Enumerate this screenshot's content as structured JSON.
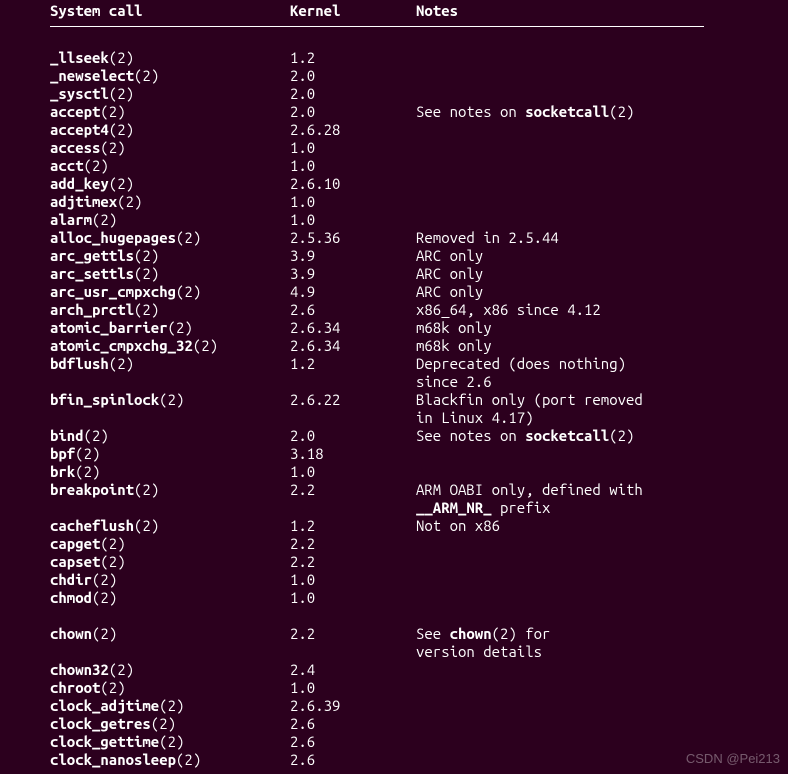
{
  "headers": {
    "col1": "System call",
    "col2": "Kernel",
    "col3": "Notes"
  },
  "rows": [
    {
      "name": "_llseek",
      "sec": "(2)",
      "kernel": "1.2",
      "notes": []
    },
    {
      "name": "_newselect",
      "sec": "(2)",
      "kernel": "2.0",
      "notes": []
    },
    {
      "name": "_sysctl",
      "sec": "(2)",
      "kernel": "2.0",
      "notes": []
    },
    {
      "name": "accept",
      "sec": "(2)",
      "kernel": "2.0",
      "notes": [
        [
          {
            "t": "See notes on "
          },
          {
            "t": "socketcall",
            "b": true
          },
          {
            "t": "(2)"
          }
        ]
      ]
    },
    {
      "name": "accept4",
      "sec": "(2)",
      "kernel": "2.6.28",
      "notes": []
    },
    {
      "name": "access",
      "sec": "(2)",
      "kernel": "1.0",
      "notes": []
    },
    {
      "name": "acct",
      "sec": "(2)",
      "kernel": "1.0",
      "notes": []
    },
    {
      "name": "add_key",
      "sec": "(2)",
      "kernel": "2.6.10",
      "notes": []
    },
    {
      "name": "adjtimex",
      "sec": "(2)",
      "kernel": "1.0",
      "notes": []
    },
    {
      "name": "alarm",
      "sec": "(2)",
      "kernel": "1.0",
      "notes": []
    },
    {
      "name": "alloc_hugepages",
      "sec": "(2)",
      "kernel": "2.5.36",
      "notes": [
        [
          {
            "t": "Removed in 2.5.44"
          }
        ]
      ]
    },
    {
      "name": "arc_gettls",
      "sec": "(2)",
      "kernel": "3.9",
      "notes": [
        [
          {
            "t": "ARC only"
          }
        ]
      ]
    },
    {
      "name": "arc_settls",
      "sec": "(2)",
      "kernel": "3.9",
      "notes": [
        [
          {
            "t": "ARC only"
          }
        ]
      ]
    },
    {
      "name": "arc_usr_cmpxchg",
      "sec": "(2)",
      "kernel": "4.9",
      "notes": [
        [
          {
            "t": "ARC only"
          }
        ]
      ]
    },
    {
      "name": "arch_prctl",
      "sec": "(2)",
      "kernel": "2.6",
      "notes": [
        [
          {
            "t": "x86_64, x86 since 4.12"
          }
        ]
      ]
    },
    {
      "name": "atomic_barrier",
      "sec": "(2)",
      "kernel": "2.6.34",
      "notes": [
        [
          {
            "t": "m68k only"
          }
        ]
      ]
    },
    {
      "name": "atomic_cmpxchg_32",
      "sec": "(2)",
      "kernel": "2.6.34",
      "notes": [
        [
          {
            "t": "m68k only"
          }
        ]
      ]
    },
    {
      "name": "bdflush",
      "sec": "(2)",
      "kernel": "1.2",
      "notes": [
        [
          {
            "t": "Deprecated (does nothing)"
          }
        ],
        [
          {
            "t": "since 2.6"
          }
        ]
      ]
    },
    {
      "name": "bfin_spinlock",
      "sec": "(2)",
      "kernel": "2.6.22",
      "notes": [
        [
          {
            "t": "Blackfin only (port removed"
          }
        ],
        [
          {
            "t": "in Linux 4.17)"
          }
        ]
      ]
    },
    {
      "name": "bind",
      "sec": "(2)",
      "kernel": "2.0",
      "notes": [
        [
          {
            "t": "See notes on "
          },
          {
            "t": "socketcall",
            "b": true
          },
          {
            "t": "(2)"
          }
        ]
      ]
    },
    {
      "name": "bpf",
      "sec": "(2)",
      "kernel": "3.18",
      "notes": []
    },
    {
      "name": "brk",
      "sec": "(2)",
      "kernel": "1.0",
      "notes": []
    },
    {
      "name": "breakpoint",
      "sec": "(2)",
      "kernel": "2.2",
      "notes": [
        [
          {
            "t": "ARM OABI only, defined with"
          }
        ],
        [
          {
            "t": "__ARM_NR_",
            "b": true
          },
          {
            "t": " prefix"
          }
        ]
      ]
    },
    {
      "name": "cacheflush",
      "sec": "(2)",
      "kernel": "1.2",
      "notes": [
        [
          {
            "t": "Not on x86"
          }
        ]
      ]
    },
    {
      "name": "capget",
      "sec": "(2)",
      "kernel": "2.2",
      "notes": []
    },
    {
      "name": "capset",
      "sec": "(2)",
      "kernel": "2.2",
      "notes": []
    },
    {
      "name": "chdir",
      "sec": "(2)",
      "kernel": "1.0",
      "notes": []
    },
    {
      "name": "chmod",
      "sec": "(2)",
      "kernel": "1.0",
      "notes": []
    },
    {
      "blank": true
    },
    {
      "name": "chown",
      "sec": "(2)",
      "kernel": "2.2",
      "notes": [
        [
          {
            "t": "See "
          },
          {
            "t": "chown",
            "b": true
          },
          {
            "t": "(2) for"
          }
        ],
        [
          {
            "t": "version details"
          }
        ]
      ]
    },
    {
      "name": "chown32",
      "sec": "(2)",
      "kernel": "2.4",
      "notes": []
    },
    {
      "name": "chroot",
      "sec": "(2)",
      "kernel": "1.0",
      "notes": []
    },
    {
      "name": "clock_adjtime",
      "sec": "(2)",
      "kernel": "2.6.39",
      "notes": []
    },
    {
      "name": "clock_getres",
      "sec": "(2)",
      "kernel": "2.6",
      "notes": []
    },
    {
      "name": "clock_gettime",
      "sec": "(2)",
      "kernel": "2.6",
      "notes": []
    },
    {
      "name": "clock_nanosleep",
      "sec": "(2)",
      "kernel": "2.6",
      "notes": []
    }
  ],
  "watermark": "CSDN @Pei213"
}
